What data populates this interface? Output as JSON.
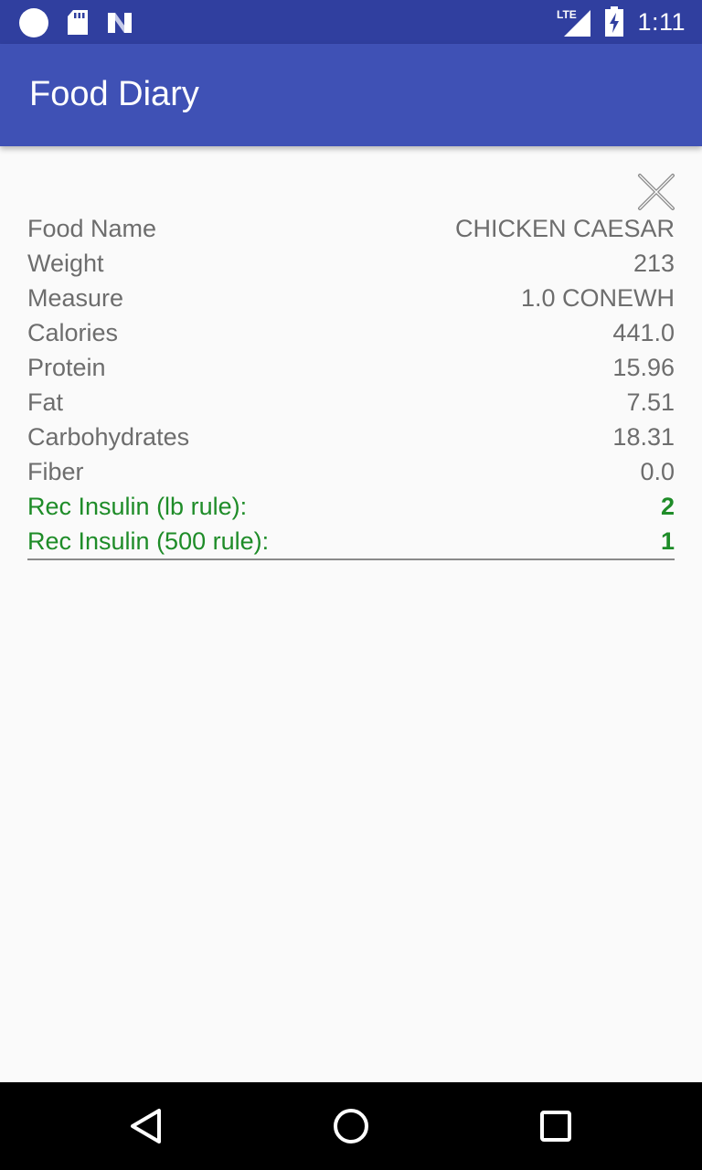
{
  "status_bar": {
    "network_label": "LTE",
    "time": "1:11"
  },
  "app_bar": {
    "title": "Food Diary"
  },
  "details": {
    "rows": [
      {
        "label": "Food Name",
        "value": "CHICKEN CAESAR"
      },
      {
        "label": "Weight",
        "value": "213"
      },
      {
        "label": "Measure",
        "value": "1.0 CONEWH"
      },
      {
        "label": "Calories",
        "value": "441.0"
      },
      {
        "label": "Protein",
        "value": "15.96"
      },
      {
        "label": "Fat",
        "value": "7.51"
      },
      {
        "label": "Carbohydrates",
        "value": "18.31"
      },
      {
        "label": "Fiber",
        "value": "0.0"
      }
    ],
    "insulin": [
      {
        "label": "Rec Insulin (lb rule):",
        "value": "2"
      },
      {
        "label": "Rec Insulin (500 rule):",
        "value": "1"
      }
    ]
  },
  "colors": {
    "status_bar": "#303f9f",
    "app_bar": "#3f51b5",
    "text_gray": "#6d6d6d",
    "insulin_green": "#1e8c28"
  },
  "icons": {
    "close": "close-icon",
    "back": "back-triangle-icon",
    "home": "home-circle-icon",
    "recents": "recents-square-icon"
  }
}
